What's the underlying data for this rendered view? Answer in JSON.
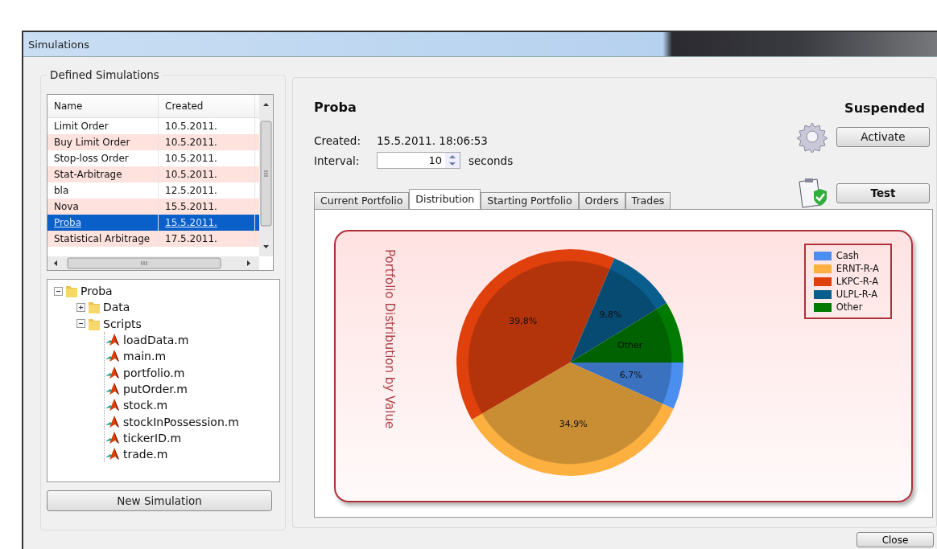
{
  "window": {
    "title": "Simulations"
  },
  "defined_simulations": {
    "title": "Defined Simulations",
    "table": {
      "columns": [
        "Name",
        "Created"
      ],
      "rows": [
        {
          "name": "Limit Order",
          "created": "10.5.2011.",
          "selected": false
        },
        {
          "name": "Buy Limit Order",
          "created": "10.5.2011.",
          "selected": false
        },
        {
          "name": "Stop-loss Order",
          "created": "10.5.2011.",
          "selected": false
        },
        {
          "name": "Stat-Arbitrage",
          "created": "10.5.2011.",
          "selected": false
        },
        {
          "name": "bla",
          "created": "12.5.2011.",
          "selected": false
        },
        {
          "name": "Nova",
          "created": "15.5.2011.",
          "selected": false
        },
        {
          "name": "Proba",
          "created": "15.5.2011.",
          "selected": true
        },
        {
          "name": "Statistical Arbitrage",
          "created": "17.5.2011.",
          "selected": false
        }
      ]
    },
    "tree": [
      {
        "label": "Proba",
        "kind": "folder",
        "expanded": true,
        "children": [
          {
            "label": "Data",
            "kind": "folder",
            "expanded": false
          },
          {
            "label": "Scripts",
            "kind": "folder",
            "expanded": true,
            "children": [
              {
                "label": "loadData.m",
                "kind": "file"
              },
              {
                "label": "main.m",
                "kind": "file"
              },
              {
                "label": "portfolio.m",
                "kind": "file"
              },
              {
                "label": "putOrder.m",
                "kind": "file"
              },
              {
                "label": "stock.m",
                "kind": "file"
              },
              {
                "label": "stockInPossession.m",
                "kind": "file"
              },
              {
                "label": "tickerID.m",
                "kind": "file"
              },
              {
                "label": "trade.m",
                "kind": "file"
              }
            ]
          }
        ]
      }
    ],
    "new_button": "New Simulation"
  },
  "detail": {
    "name": "Proba",
    "status": "Suspended",
    "created_label": "Created:",
    "created": "15.5.2011. 18:06:53",
    "interval_label": "Interval:",
    "interval": "10",
    "interval_unit": "seconds",
    "buttons": [
      {
        "label": "Activate",
        "kind": "activate"
      },
      {
        "label": "Test",
        "kind": "test"
      }
    ],
    "tabs": [
      {
        "label": "Current Portfolio",
        "selected": false
      },
      {
        "label": "Distribution",
        "selected": true
      },
      {
        "label": "Starting Portfolio",
        "selected": false
      },
      {
        "label": "Orders",
        "selected": false
      },
      {
        "label": "Trades",
        "selected": false
      }
    ],
    "chart_data": {
      "type": "pie",
      "title": "Portfolio Distribution by Value",
      "categories": [
        "Cash",
        "ERNT-R-A",
        "LKPC-R-A",
        "ULPL-R-A",
        "Other"
      ],
      "values": [
        6.7,
        34.9,
        39.8,
        9.8,
        8.8
      ],
      "colors": [
        "#4a8ef0",
        "#fbb040",
        "#e0400c",
        "#0a5e8e",
        "#007a00"
      ],
      "legend": "right",
      "value_labels": [
        "6,7%",
        "34,9%",
        "39,8%",
        "9,8%",
        "Other"
      ]
    }
  },
  "close_button": "Close"
}
